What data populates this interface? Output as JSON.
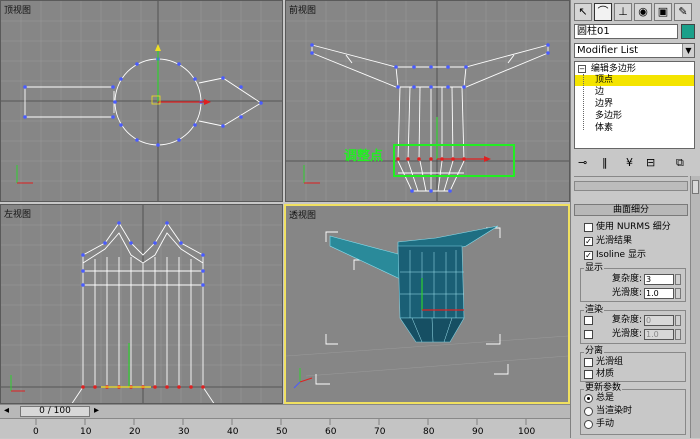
{
  "viewports": {
    "top": {
      "label": "顶视图"
    },
    "front": {
      "label": "前视图",
      "annotation": "调整点"
    },
    "left": {
      "label": "左视图"
    },
    "perspective": {
      "label": "透视图"
    }
  },
  "command_panel": {
    "object_name": "圆柱01",
    "object_color": "#1aa08a",
    "modifier_list": "Modifier List",
    "stack": {
      "modifier": "编辑多边形",
      "subobjects": [
        "顶点",
        "边",
        "边界",
        "多边形",
        "体素"
      ],
      "selected": "顶点"
    },
    "subdivision_surface": {
      "title": "曲面细分",
      "use_nurms": "使用 NURMS 细分",
      "smooth_result": "光滑结果",
      "isoline_display": "Isoline 显示",
      "display_group": "显示",
      "render_group": "渲染",
      "iterations_label": "复杂度:",
      "smoothness_label": "光滑度:",
      "display_iterations": "3",
      "display_smoothness": "1.0",
      "render_iterations": "0",
      "render_smoothness": "1.0",
      "separate_group": "分离",
      "smoothing_groups": "光滑组",
      "materials": "材质",
      "update_group": "更新参数",
      "always": "总是",
      "when_rendering": "当渲染时",
      "manually": "手动"
    }
  },
  "timeline": {
    "slider": "0 / 100",
    "ticks": [
      "0",
      "10",
      "20",
      "30",
      "40",
      "50",
      "60",
      "70",
      "80",
      "90",
      "100"
    ]
  }
}
